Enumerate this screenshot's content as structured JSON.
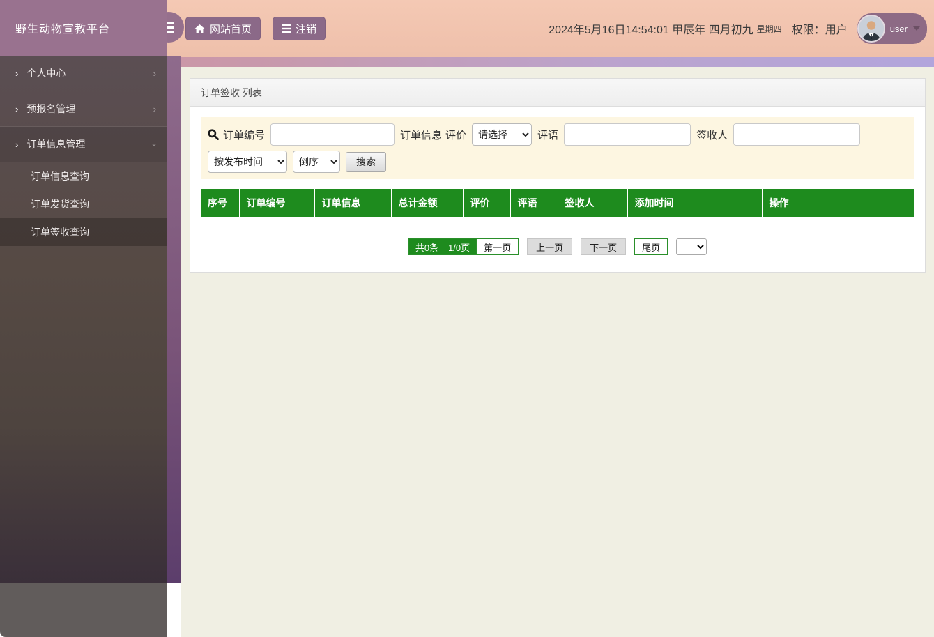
{
  "brand": {
    "title": "野生动物宣教平台"
  },
  "header": {
    "home_button": "网站首页",
    "logout_button": "注销",
    "datetime": "2024年5月16日14:54:01 甲辰年 四月初九",
    "weekday": "星期四",
    "permission_label": "权限：",
    "role": "用户",
    "username": "user"
  },
  "sidebar": {
    "items": [
      {
        "label": "个人中心"
      },
      {
        "label": "预报名管理"
      },
      {
        "label": "订单信息管理",
        "expanded": true,
        "children": [
          "订单信息查询",
          "订单发货查询",
          "订单签收查询"
        ],
        "active_child": "订单签收查询"
      }
    ]
  },
  "panel": {
    "title": "订单签收 列表",
    "search": {
      "order_no_label": "订单编号",
      "order_info_label": "订单信息",
      "rating_label": "评价",
      "rating_select_value": "请选择",
      "comment_label": "评语",
      "receiver_label": "签收人",
      "sort_field_value": "按发布时间",
      "sort_order_value": "倒序",
      "search_button": "搜索"
    },
    "table": {
      "headers": [
        "序号",
        "订单编号",
        "订单信息",
        "总计金额",
        "评价",
        "评语",
        "签收人",
        "添加时间",
        "操作"
      ],
      "rows": []
    },
    "pagination": {
      "total": "共0条",
      "page_indicator": "1/0页",
      "first": "第一页",
      "prev": "上一页",
      "next": "下一页",
      "last": "尾页"
    }
  },
  "colors": {
    "header_pink": "#f1c3ae",
    "accent_strip_left": "#d2929e",
    "accent_strip_right": "#b2a5dc",
    "brand_purple": "#99728f",
    "sidebar_dark": "#554a46",
    "content_beige": "#f0efe3",
    "table_header_green": "#1e8b1e",
    "search_bar_cream": "#fdf6e1",
    "button_purple": "#8b6988"
  }
}
